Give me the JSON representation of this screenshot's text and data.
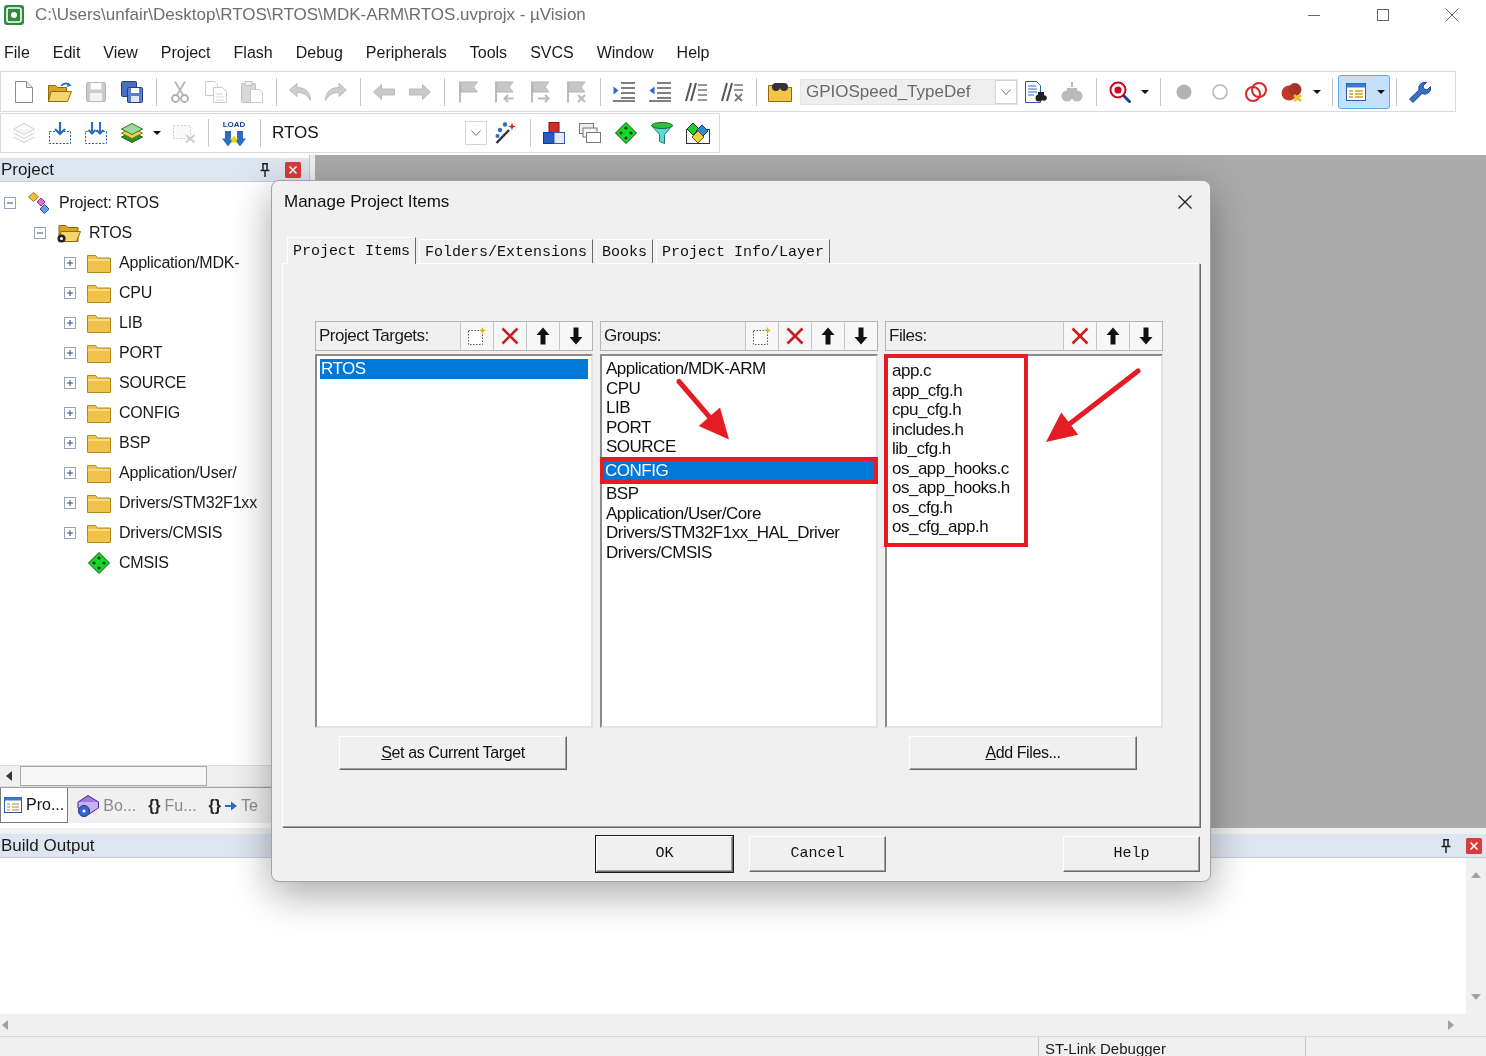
{
  "window": {
    "title": "C:\\Users\\unfair\\Desktop\\RTOS\\RTOS\\MDK-ARM\\RTOS.uvprojx - µVision"
  },
  "menu": [
    "File",
    "Edit",
    "View",
    "Project",
    "Flash",
    "Debug",
    "Peripherals",
    "Tools",
    "SVCS",
    "Window",
    "Help"
  ],
  "toolbar_1": [
    [
      {
        "kind": "new",
        "disabled": false,
        "selected": false,
        "dropdown": false
      },
      {
        "kind": "open",
        "disabled": false,
        "selected": false,
        "dropdown": false
      },
      {
        "kind": "save",
        "disabled": true,
        "selected": false,
        "dropdown": false
      },
      {
        "kind": "saveall",
        "disabled": false,
        "selected": false,
        "dropdown": false
      }
    ],
    [
      {
        "kind": "cut",
        "disabled": true,
        "selected": false,
        "dropdown": false
      },
      {
        "kind": "copy",
        "disabled": true,
        "selected": false,
        "dropdown": false
      },
      {
        "kind": "paste",
        "disabled": true,
        "selected": false,
        "dropdown": false
      }
    ],
    [
      {
        "kind": "undo",
        "disabled": true,
        "selected": false,
        "dropdown": false
      },
      {
        "kind": "redo",
        "disabled": true,
        "selected": false,
        "dropdown": false
      }
    ],
    [
      {
        "kind": "back",
        "disabled": true,
        "selected": false,
        "dropdown": false
      },
      {
        "kind": "forward",
        "disabled": true,
        "selected": false,
        "dropdown": false
      }
    ],
    [
      {
        "kind": "bookmark",
        "disabled": true,
        "selected": false,
        "dropdown": false
      },
      {
        "kind": "prevmark",
        "disabled": true,
        "selected": false,
        "dropdown": false
      },
      {
        "kind": "nextmark",
        "disabled": true,
        "selected": false,
        "dropdown": false
      },
      {
        "kind": "clearmarks",
        "disabled": true,
        "selected": false,
        "dropdown": false
      }
    ],
    [
      {
        "kind": "indent",
        "disabled": false,
        "selected": false,
        "dropdown": false
      },
      {
        "kind": "outdent",
        "disabled": false,
        "selected": false,
        "dropdown": false
      },
      {
        "kind": "comment",
        "disabled": false,
        "selected": false,
        "dropdown": false
      },
      {
        "kind": "uncomment",
        "disabled": false,
        "selected": false,
        "dropdown": false
      }
    ],
    [
      {
        "kind": "findfiles",
        "disabled": false,
        "selected": false,
        "dropdown": false
      },
      {
        "kind": "combo",
        "value": "GPIOSpeed_TypeDef",
        "disabled": true,
        "selected": false,
        "dropdown": true
      },
      {
        "kind": "find",
        "disabled": false,
        "selected": false,
        "dropdown": false
      },
      {
        "kind": "incfind",
        "disabled": true,
        "selected": false,
        "dropdown": false
      }
    ],
    [
      {
        "kind": "debug",
        "disabled": false,
        "selected": false,
        "dropdown": true
      }
    ],
    [
      {
        "kind": "bpinsert",
        "disabled": true,
        "selected": false,
        "dropdown": false
      },
      {
        "kind": "bpenable",
        "disabled": true,
        "selected": false,
        "dropdown": false
      },
      {
        "kind": "bpkill",
        "disabled": false,
        "selected": false,
        "dropdown": false
      },
      {
        "kind": "bpdisable",
        "disabled": false,
        "selected": false,
        "dropdown": true
      }
    ],
    [
      {
        "kind": "layout",
        "disabled": false,
        "selected": true,
        "dropdown": true
      }
    ],
    [
      {
        "kind": "configure",
        "disabled": false,
        "selected": false,
        "dropdown": false
      }
    ]
  ],
  "toolbar_2": [
    [
      {
        "kind": "translate",
        "disabled": true,
        "selected": false,
        "dropdown": false
      },
      {
        "kind": "build",
        "disabled": false,
        "selected": false,
        "dropdown": false
      },
      {
        "kind": "rebuild",
        "disabled": false,
        "selected": false,
        "dropdown": false
      },
      {
        "kind": "batch",
        "disabled": false,
        "selected": false,
        "dropdown": true
      },
      {
        "kind": "stop",
        "disabled": true,
        "selected": false,
        "dropdown": false
      }
    ],
    [
      {
        "kind": "download",
        "label": "LOAD",
        "disabled": false,
        "selected": false,
        "dropdown": false
      }
    ],
    [
      {
        "kind": "combo",
        "value": "RTOS",
        "disabled": false,
        "selected": false,
        "dropdown": true
      },
      {
        "kind": "wand",
        "disabled": false,
        "selected": false,
        "dropdown": false
      }
    ],
    [
      {
        "kind": "manage",
        "disabled": false,
        "selected": false,
        "dropdown": false
      },
      {
        "kind": "windows",
        "disabled": false,
        "selected": false,
        "dropdown": false
      },
      {
        "kind": "diamond",
        "disabled": false,
        "selected": false,
        "dropdown": false
      },
      {
        "kind": "funnel",
        "disabled": false,
        "selected": false,
        "dropdown": false
      },
      {
        "kind": "pack",
        "disabled": false,
        "selected": false,
        "dropdown": false
      }
    ]
  ],
  "project_panel": {
    "title": "Project",
    "tree": [
      {
        "kind": "project",
        "label": "Project: RTOS",
        "expanded": true,
        "children": [
          {
            "kind": "target",
            "label": "RTOS",
            "expanded": true,
            "children": [
              {
                "kind": "group",
                "label": "Application/MDK-",
                "expanded": false
              },
              {
                "kind": "group",
                "label": "CPU",
                "expanded": false
              },
              {
                "kind": "group",
                "label": "LIB",
                "expanded": false
              },
              {
                "kind": "group",
                "label": "PORT",
                "expanded": false
              },
              {
                "kind": "group",
                "label": "SOURCE",
                "expanded": false
              },
              {
                "kind": "group",
                "label": "CONFIG",
                "expanded": false
              },
              {
                "kind": "group",
                "label": "BSP",
                "expanded": false
              },
              {
                "kind": "group",
                "label": "Application/User/",
                "expanded": false
              },
              {
                "kind": "group",
                "label": "Drivers/STM32F1xx",
                "expanded": false
              },
              {
                "kind": "group",
                "label": "Drivers/CMSIS",
                "expanded": false
              },
              {
                "kind": "component",
                "label": "CMSIS"
              }
            ]
          }
        ]
      }
    ],
    "tabs": [
      {
        "kind": "project",
        "label": "Pro...",
        "selected": true
      },
      {
        "kind": "books",
        "label": "Bo...",
        "selected": false
      },
      {
        "kind": "functions",
        "symbol": "{}",
        "label": "Fu...",
        "selected": false
      },
      {
        "kind": "templates",
        "symbol": "{}",
        "label": "Te",
        "selected": false
      }
    ]
  },
  "dialog": {
    "title": "Manage Project Items",
    "tabs": [
      {
        "label": "Project Items",
        "selected": true
      },
      {
        "label": "Folders/Extensions",
        "selected": false
      },
      {
        "label": "Books",
        "selected": false
      },
      {
        "label": "Project Info/Layer",
        "selected": false
      }
    ],
    "lists": [
      {
        "title": "Project Targets:",
        "new_button": true,
        "annotated": false,
        "button": "Set as Current Target",
        "items": [
          {
            "label": "RTOS",
            "selected": true,
            "annotated": false
          }
        ]
      },
      {
        "title": "Groups:",
        "new_button": true,
        "annotated": false,
        "items": [
          {
            "label": "Application/MDK-ARM",
            "selected": false,
            "annotated": false
          },
          {
            "label": "CPU",
            "selected": false,
            "annotated": false
          },
          {
            "label": "LIB",
            "selected": false,
            "annotated": false
          },
          {
            "label": "PORT",
            "selected": false,
            "annotated": false
          },
          {
            "label": "SOURCE",
            "selected": false,
            "annotated": false
          },
          {
            "label": "CONFIG",
            "selected": true,
            "annotated": true
          },
          {
            "label": "BSP",
            "selected": false,
            "annotated": false
          },
          {
            "label": "Application/User/Core",
            "selected": false,
            "annotated": false
          },
          {
            "label": "Drivers/STM32F1xx_HAL_Driver",
            "selected": false,
            "annotated": false
          },
          {
            "label": "Drivers/CMSIS",
            "selected": false,
            "annotated": false
          }
        ]
      },
      {
        "title": "Files:",
        "new_button": false,
        "annotated": true,
        "button": "Add Files...",
        "items": [
          {
            "label": "app.c",
            "selected": false,
            "annotated": false
          },
          {
            "label": "app_cfg.h",
            "selected": false,
            "annotated": false
          },
          {
            "label": "cpu_cfg.h",
            "selected": false,
            "annotated": false
          },
          {
            "label": "includes.h",
            "selected": false,
            "annotated": false
          },
          {
            "label": "lib_cfg.h",
            "selected": false,
            "annotated": false
          },
          {
            "label": "os_app_hooks.c",
            "selected": false,
            "annotated": false
          },
          {
            "label": "os_app_hooks.h",
            "selected": false,
            "annotated": false
          },
          {
            "label": "os_cfg.h",
            "selected": false,
            "annotated": false
          },
          {
            "label": "os_cfg_app.h",
            "selected": false,
            "annotated": false
          }
        ]
      }
    ],
    "buttons": [
      {
        "label": "OK",
        "default": true
      },
      {
        "label": "Cancel",
        "default": false
      },
      {
        "label": "Help",
        "default": false
      }
    ]
  },
  "build_output": {
    "title": "Build Output"
  },
  "status_bar": {
    "debugger": "ST-Link Debugger"
  }
}
